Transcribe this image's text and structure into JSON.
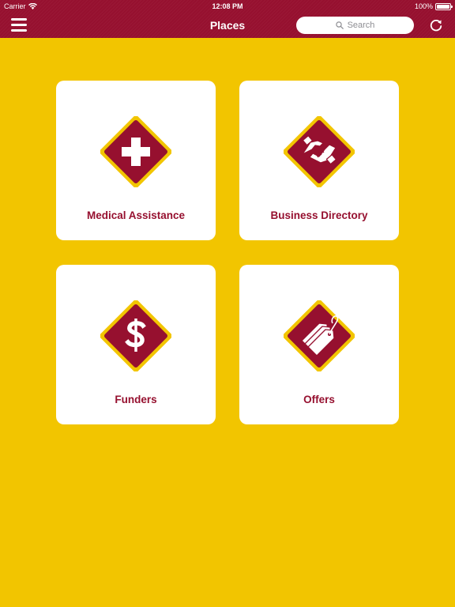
{
  "status": {
    "carrier": "Carrier",
    "time": "12:08 PM",
    "battery": "100%",
    "battery_level": 1.0
  },
  "nav": {
    "title": "Places",
    "search_placeholder": "Search",
    "menu_icon": "hamburger-menu-icon",
    "refresh_icon": "refresh-icon"
  },
  "colors": {
    "brand": "#96102F",
    "background": "#F2C500",
    "tile": "#FFFFFF"
  },
  "tiles": [
    {
      "label": "Medical Assistance",
      "icon": "medical-cross-icon"
    },
    {
      "label": "Business Directory",
      "icon": "handshake-icon"
    },
    {
      "label": "Funders",
      "icon": "dollar-sign-icon"
    },
    {
      "label": "Offers",
      "icon": "price-tags-icon"
    }
  ]
}
